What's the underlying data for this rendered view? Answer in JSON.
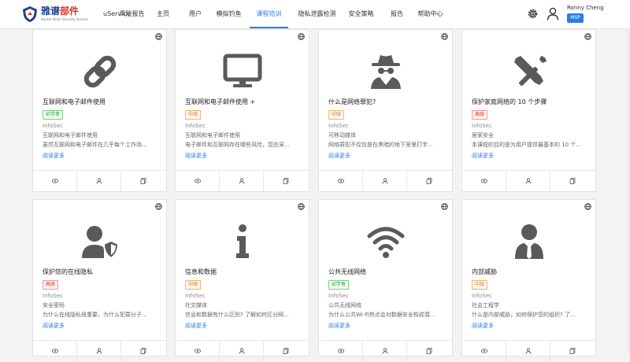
{
  "app": {
    "logo_main_a": "雅谱",
    "logo_main_b": "部件",
    "logo_sub": "Hacker Brain Security Service"
  },
  "nav": {
    "items": [
      {
        "label": "uService"
      },
      {
        "label": "风险报告"
      },
      {
        "label": "主页"
      },
      {
        "label": "用户"
      },
      {
        "label": "模拟钓鱼"
      },
      {
        "label": "课程培训",
        "active": true
      },
      {
        "label": "隐私泄露检测"
      },
      {
        "label": "安全策略"
      },
      {
        "label": "报告"
      },
      {
        "label": "帮助中心"
      }
    ]
  },
  "user": {
    "name": "Ronny Cheng",
    "role": "MSP"
  },
  "colors": {
    "accent": "#2c7be5",
    "beginner": "#2e9d3f",
    "medium": "#e07b1f",
    "advanced": "#d9342b",
    "icon": "#5a5a5a"
  },
  "courses": [
    {
      "icon": "link-icon",
      "title": "互联网和电子邮件使用",
      "level": "初学者",
      "level_key": "beginner",
      "org": "InfoSec",
      "category": "互联网和电子邮件使用",
      "desc": "虽然互联网和电子邮件在几乎每个工作场...",
      "link": "阅读更多"
    },
    {
      "icon": "monitor-icon",
      "title": "互联网和电子邮件使用 +",
      "level": "中级",
      "level_key": "medium",
      "org": "InfoSec",
      "category": "互联网和电子邮件使用",
      "desc": "电子邮件和互联网存在哪些风险，您应采...",
      "link": "阅读更多"
    },
    {
      "icon": "spy-icon",
      "title": "什么是网络罪犯?",
      "level": "中级",
      "level_key": "medium",
      "org": "InfoSec",
      "category": "可移动媒体",
      "desc": "网络罪犯不仅仅是在黑暗的地下室里打字...",
      "link": "阅读更多"
    },
    {
      "icon": "tools-icon",
      "title": "保护家庭网络的 10 个步骤",
      "level": "高级",
      "level_key": "advanced",
      "org": "InfoSec",
      "category": "居家安全",
      "desc": "本课程的目的是为用户提供最基本的 10 个...",
      "link": "阅读更多"
    },
    {
      "icon": "user-shield-icon",
      "title": "保护您的在线隐私",
      "level": "高级",
      "level_key": "advanced",
      "org": "InfoSec",
      "category": "安全密码",
      "desc": "为什么在线隐私很重要，为什么犯罪分子...",
      "link": "阅读更多"
    },
    {
      "icon": "info-icon",
      "title": "信息和数据",
      "level": "中级",
      "level_key": "medium",
      "org": "InfoSec",
      "category": "社交媒体",
      "desc": "信息和数据有什么区别? 了解如何区分网...",
      "link": "阅读更多"
    },
    {
      "icon": "wifi-icon",
      "title": "公共无线网络",
      "level": "初学者",
      "level_key": "beginner",
      "org": "InfoSec",
      "category": "公共无线网络",
      "desc": "为什么公共Wi-Fi热点会对数据安全构成潜...",
      "link": "阅读更多"
    },
    {
      "icon": "user-tie-icon",
      "title": "内部威胁",
      "level": "中级",
      "level_key": "medium",
      "org": "InfoSec",
      "category": "社会工程学",
      "desc": "什么是内部威胁，如何保护您的组织? 了...",
      "link": "阅读更多"
    }
  ]
}
